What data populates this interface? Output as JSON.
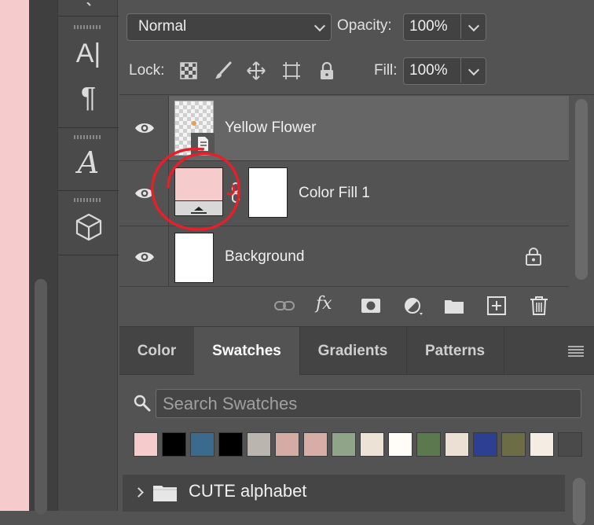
{
  "tools": {
    "type_label": "A|",
    "paragraph_label": "¶",
    "glyph_label": "A",
    "items": [
      "character-tool",
      "paragraph-tool",
      "glyphs-tool",
      "3d-tool"
    ]
  },
  "layers": {
    "blend_mode": "Normal",
    "opacity_label": "Opacity:",
    "opacity_value": "100%",
    "lock_label": "Lock:",
    "fill_label": "Fill:",
    "fill_value": "100%",
    "rows": [
      {
        "name": "Yellow Flower",
        "selected": true
      },
      {
        "name": "Color Fill 1",
        "selected": false
      },
      {
        "name": "Background",
        "selected": false,
        "locked": true
      }
    ],
    "fx_label": "fx"
  },
  "swatches_panel": {
    "tabs": [
      {
        "label": "Color",
        "active": false
      },
      {
        "label": "Swatches",
        "active": true
      },
      {
        "label": "Gradients",
        "active": false
      },
      {
        "label": "Patterns",
        "active": false
      }
    ],
    "search_placeholder": "Search Swatches",
    "colors": [
      "#f5cccb",
      "#000000",
      "#3a6a8e",
      "#000000",
      "#bab6af",
      "#d5aca4",
      "#d8ada6",
      "#8fa488",
      "#ede2d6",
      "#fffdf6",
      "#5a7a4d",
      "#ece0d4",
      "#2c3f93",
      "#6c6d44",
      "#f5ede3",
      "#4a4a4a"
    ],
    "folder_name": "CUTE alphabet"
  },
  "colors": {
    "panel_bg": "#535353",
    "selected_row": "#666666",
    "annotation": "#e4202a",
    "canvas": "#f5cccb"
  }
}
